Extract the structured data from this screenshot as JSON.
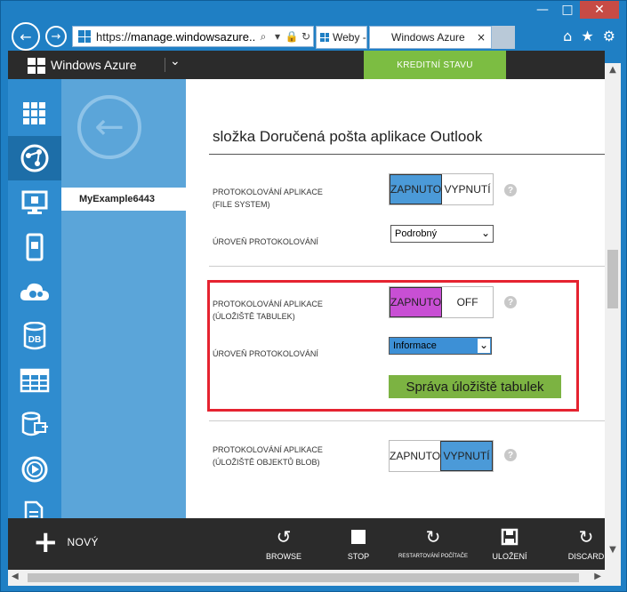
{
  "browser": {
    "url_prefix": "https://",
    "url_host": "manage.windowsazure....",
    "tab1_label": "Weby -",
    "tab2_label": "Windows Azure",
    "tab_close_glyph": "×",
    "icons": [
      "back-icon",
      "forward-icon",
      "search-icon",
      "lock-icon",
      "refresh-icon",
      "home-icon",
      "favorites-icon",
      "settings-icon"
    ]
  },
  "header": {
    "title": "Windows Azure",
    "credit_button": "KREDITNÍ STAVU"
  },
  "subnav": {
    "item": "MyExample6443"
  },
  "main": {
    "section_title": "složka Doručená pošta aplikace Outlook",
    "fs": {
      "label_line1": "PROTOKOLOVÁNÍ APLIKACE",
      "label_line2": "(FILE SYSTEM)",
      "toggle_on": "ZAPNUTO",
      "toggle_off": "VYPNUTÍ",
      "level_label": "ÚROVEŇ PROTOKOLOVÁNÍ",
      "level_value": "Podrobný"
    },
    "table": {
      "label_line1": "PROTOKOLOVÁNÍ APLIKACE",
      "label_line2": "(ÚLOŽIŠTĚ TABULEK)",
      "toggle_on": "ZAPNUTO",
      "toggle_off": "OFF",
      "level_label": "ÚROVEŇ PROTOKOLOVÁNÍ",
      "level_value": "Informace",
      "manage_button": "Správa úložiště tabulek"
    },
    "blob": {
      "label_line1": "PROTOKOLOVÁNÍ APLIKACE",
      "label_line2": "(ÚLOŽIŠTĚ OBJEKTŮ BLOB)",
      "toggle_on": "ZAPNUTO",
      "toggle_off": "VYPNUTÍ"
    },
    "help_glyph": "?"
  },
  "bottombar": {
    "new_label": "NOVÝ",
    "browse": "BROWSE",
    "stop": "STOP",
    "restart": "RESTARTOVÁNÍ POČÍTAČE",
    "save": "ULOŽENÍ",
    "discard": "DISCARD"
  },
  "colors": {
    "accent_blue": "#2f8ccf",
    "credit_green": "#7cbd42",
    "toggle_magenta": "#c84fd4",
    "highlight_red": "#e52330"
  }
}
